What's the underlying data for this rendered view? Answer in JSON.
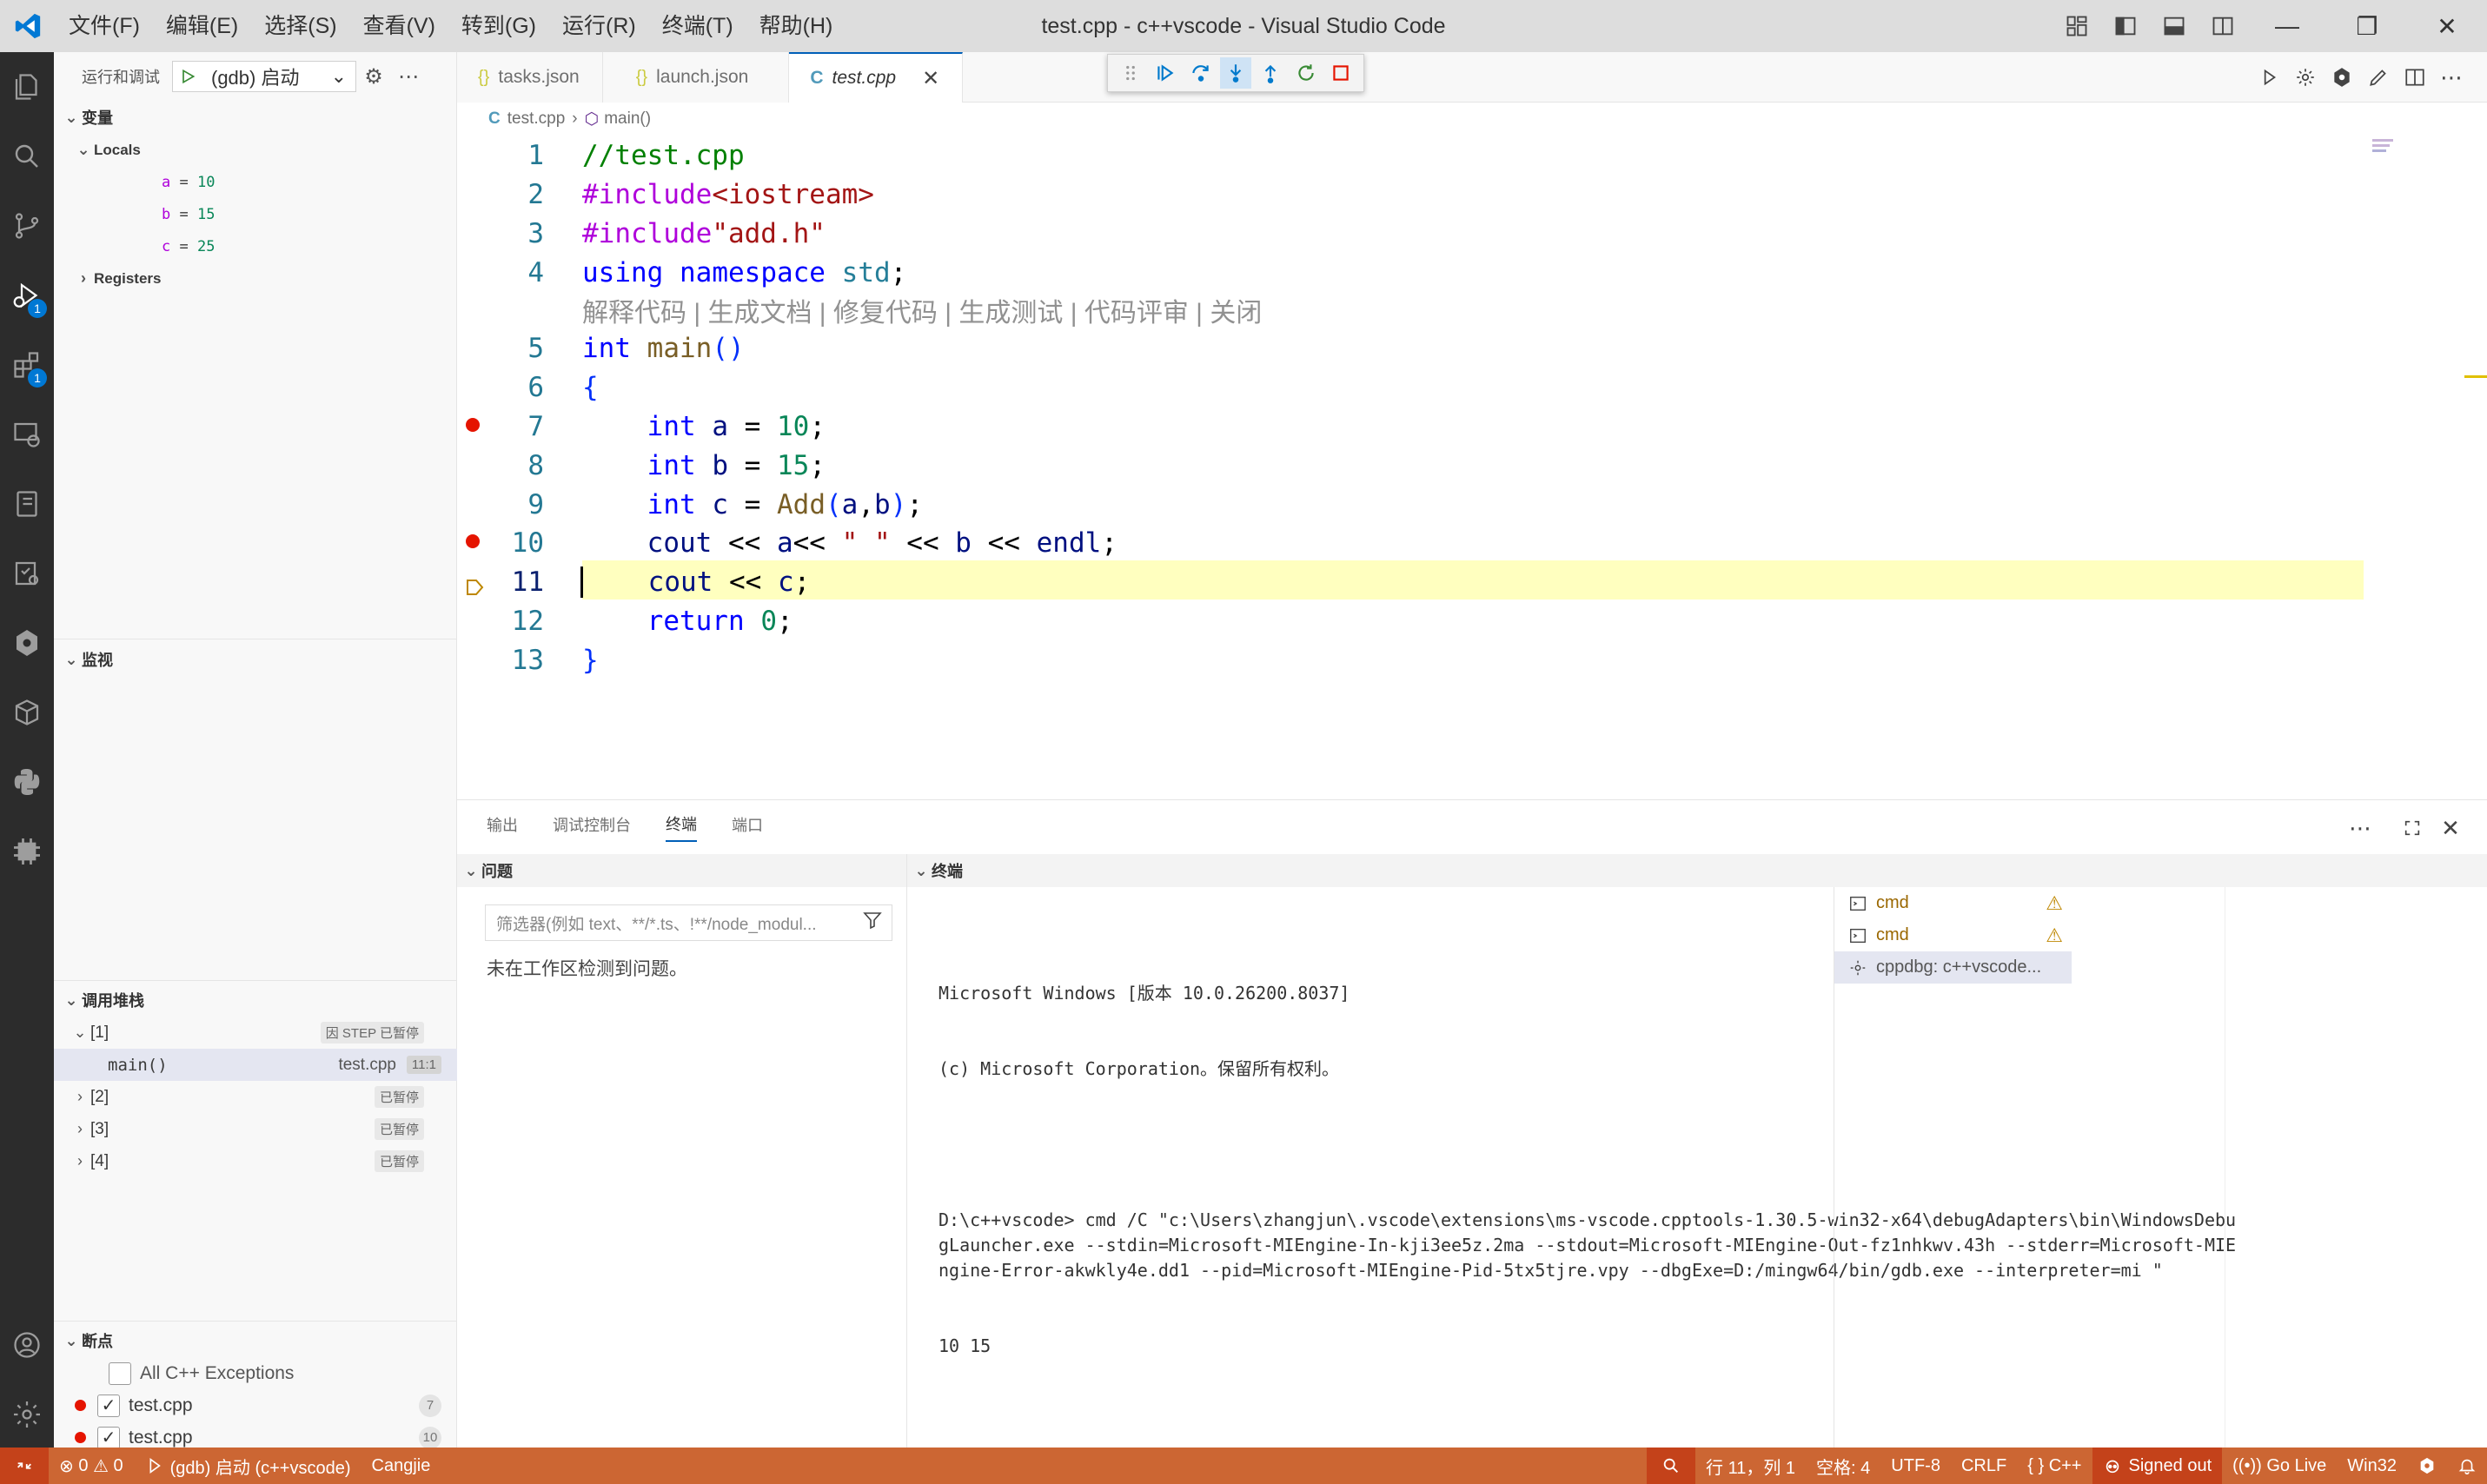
{
  "colors": {
    "accent": "#005fb8",
    "status_bar": "#cc6633",
    "activity_bar": "#2c2c2c",
    "breakpoint": "#e51400",
    "current_line": "#fffbbf"
  },
  "titlebar": {
    "menus": [
      "文件(F)",
      "编辑(E)",
      "选择(S)",
      "查看(V)",
      "转到(G)",
      "运行(R)",
      "终端(T)",
      "帮助(H)"
    ],
    "title": "test.cpp - c++vscode - Visual Studio Code",
    "minimize": "—",
    "restore": "❐",
    "close": "✕"
  },
  "activity_bar": {
    "run_badge": "1",
    "extensions_badge": "1"
  },
  "sidebar": {
    "header_label": "运行和调试",
    "run_config": "(gdb) 启动",
    "variables": {
      "title": "变量",
      "locals_label": "Locals",
      "locals": [
        {
          "name": "a",
          "eq": "=",
          "value": "10"
        },
        {
          "name": "b",
          "eq": "=",
          "value": "15"
        },
        {
          "name": "c",
          "eq": "=",
          "value": "25"
        }
      ],
      "registers_label": "Registers"
    },
    "watch": {
      "title": "监视"
    },
    "call_stack": {
      "title": "调用堆栈",
      "threads": [
        {
          "label": "[1]",
          "tag": "因 STEP 已暂停",
          "frames": [
            {
              "name": "main()",
              "file": "test.cpp",
              "pos": "11:1"
            }
          ]
        },
        {
          "label": "[2]",
          "tag": "已暂停"
        },
        {
          "label": "[3]",
          "tag": "已暂停"
        },
        {
          "label": "[4]",
          "tag": "已暂停"
        }
      ]
    },
    "breakpoints": {
      "title": "断点",
      "items": [
        {
          "label": "All C++ Exceptions",
          "checked": false,
          "count": ""
        },
        {
          "label": "test.cpp",
          "checked": true,
          "count": "7"
        },
        {
          "label": "test.cpp",
          "checked": true,
          "count": "10"
        }
      ]
    }
  },
  "editor": {
    "tabs": [
      {
        "label": "tasks.json",
        "icon": "{}"
      },
      {
        "label": "launch.json",
        "icon": "{}"
      },
      {
        "label": "test.cpp",
        "icon": "C",
        "close": "✕"
      }
    ],
    "breadcrumb": {
      "file": "test.cpp",
      "symbol": "main()",
      "sep": "›"
    },
    "line_numbers": [
      "1",
      "2",
      "3",
      "4",
      "5",
      "6",
      "7",
      "8",
      "9",
      "10",
      "11",
      "12",
      "13"
    ],
    "codelens": "解释代码 | 生成文档 | 修复代码 | 生成测试 | 代码评审 | 关闭"
  },
  "panel": {
    "tabs": [
      "输出",
      "调试控制台",
      "终端",
      "端口"
    ],
    "problems_title": "问题",
    "filter_placeholder": "筛选器(例如 text、**/*.ts、!**/node_modul...",
    "no_problems": "未在工作区检测到问题。",
    "terminal_title": "终端",
    "terminal_lines": [
      "Microsoft Windows [版本 10.0.26200.8037]",
      "(c) Microsoft Corporation。保留所有权利。",
      "",
      "D:\\c++vscode> cmd /C \"c:\\Users\\zhangjun\\.vscode\\extensions\\ms-vscode.cpptools-1.30.5-win32-x64\\debugAdapters\\bin\\WindowsDebugLauncher.exe --stdin=Microsoft-MIEngine-In-kji3ee5z.2ma --stdout=Microsoft-MIEngine-Out-fz1nhkwv.43h --stderr=Microsoft-MIEngine-Error-akwkly4e.dd1 --pid=Microsoft-MIEngine-Pid-5tx5tjre.vpy --dbgExe=D:/mingw64/bin/gdb.exe --interpreter=mi \"",
      "10 15"
    ],
    "terminal_list": [
      {
        "label": "cmd",
        "warn": "⚠"
      },
      {
        "label": "cmd",
        "warn": "⚠"
      },
      {
        "label": "cppdbg: c++vscode...",
        "warn": ""
      }
    ]
  },
  "statusbar": {
    "errors": "0",
    "warnings": "0",
    "debug_config": "(gdb) 启动 (c++vscode)",
    "cangjie": "Cangjie",
    "position": "行 11，列 1",
    "spaces": "空格: 4",
    "encoding": "UTF-8",
    "eol": "CRLF",
    "language": "C++",
    "account": "Signed out",
    "golive": "Go Live",
    "platform": "Win32"
  }
}
